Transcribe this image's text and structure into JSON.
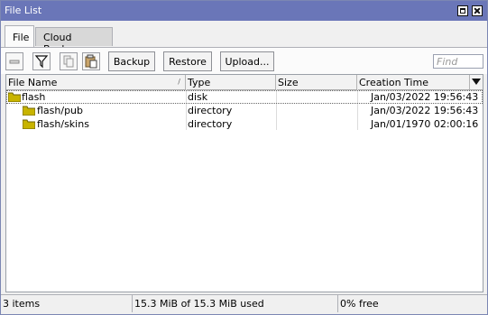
{
  "window": {
    "title": "File List"
  },
  "tabs": [
    {
      "label": "File"
    },
    {
      "label": "Cloud Backup"
    }
  ],
  "toolbar": {
    "backup_label": "Backup",
    "restore_label": "Restore",
    "upload_label": "Upload...",
    "find_placeholder": "Find"
  },
  "table": {
    "columns": [
      "File Name",
      "Type",
      "Size",
      "Creation Time"
    ],
    "rows": [
      {
        "name": "flash",
        "type": "disk",
        "size": "",
        "created": "Jan/03/2022 19:56:43"
      },
      {
        "name": "flash/pub",
        "type": "directory",
        "size": "",
        "created": "Jan/03/2022 19:56:43"
      },
      {
        "name": "flash/skins",
        "type": "directory",
        "size": "",
        "created": "Jan/01/1970 02:00:16"
      }
    ]
  },
  "status": {
    "items": "3 items",
    "usage": "15.3 MiB of 15.3 MiB used",
    "free": "0% free"
  },
  "colors": {
    "titlebar": "#6a76b8",
    "folder": "#c8b400"
  }
}
